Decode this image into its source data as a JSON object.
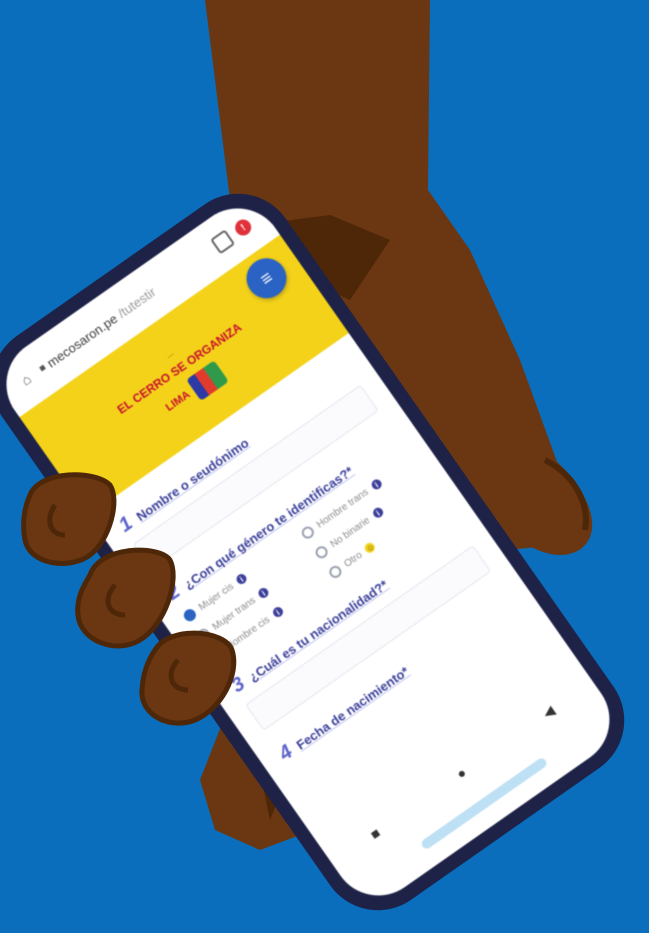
{
  "browser": {
    "url_domain": "mecosaron.pe",
    "url_path": "/tutestir"
  },
  "banner": {
    "line1": "...",
    "line2": "EL CERRO SE ORGANIZA",
    "line3": "LIMA"
  },
  "form": {
    "questions": [
      {
        "number": "1",
        "text": "Nombre o seudónimo"
      },
      {
        "number": "2",
        "text": "¿Con qué género te identificas?*",
        "options": [
          "Mujer cis",
          "Hombre trans",
          "Mujer trans",
          "No binarie",
          "Hombre cis",
          "Otro"
        ]
      },
      {
        "number": "3",
        "text": "¿Cuál es tu nacionalidad?*"
      },
      {
        "number": "4",
        "text": "Fecha de nacimiento*"
      }
    ]
  },
  "colors": {
    "background": "#0a6ebd",
    "skin": "#6a3712",
    "phone_frame": "#1e2247",
    "banner": "#f4d21a",
    "accent": "#2b63c4"
  }
}
